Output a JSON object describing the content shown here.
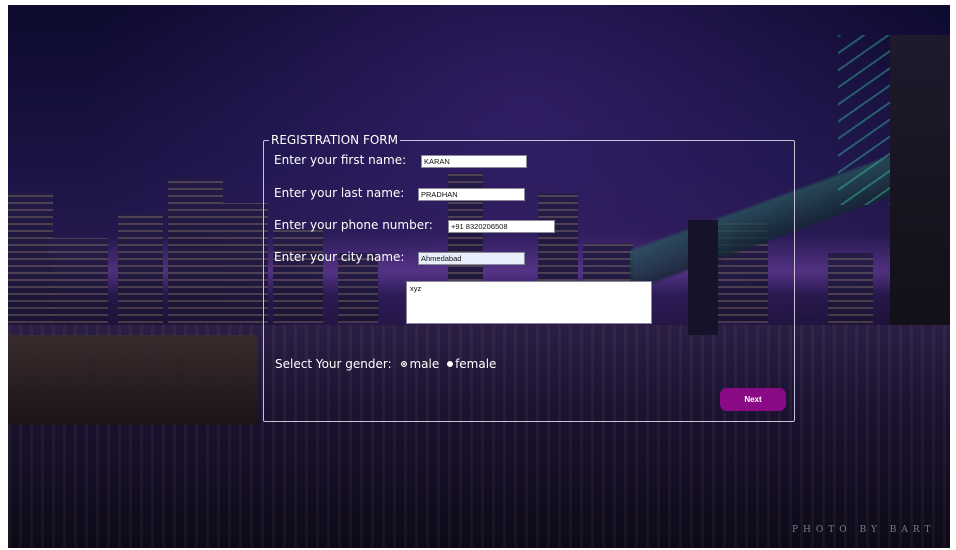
{
  "form": {
    "legend": "REGISTRATION FORM",
    "first_name": {
      "label": "Enter your first name:",
      "value": "KARAN"
    },
    "last_name": {
      "label": "Enter your last name:",
      "value": "PRADHAN"
    },
    "phone": {
      "label": "Enter your phone number:",
      "value": "+91 8320206508"
    },
    "city": {
      "label": "Enter your city name:",
      "value": "Ahmedabad"
    },
    "address": {
      "value": "xyz"
    },
    "gender": {
      "label": "Select Your gender:",
      "options": [
        "male",
        "female"
      ],
      "selected": "female"
    },
    "next_label": "Next"
  },
  "background": {
    "credit": "PHOTO BY BART"
  },
  "colors": {
    "button": "#8a0a86",
    "text": "#ffffff",
    "border": "#c7c2d6"
  }
}
